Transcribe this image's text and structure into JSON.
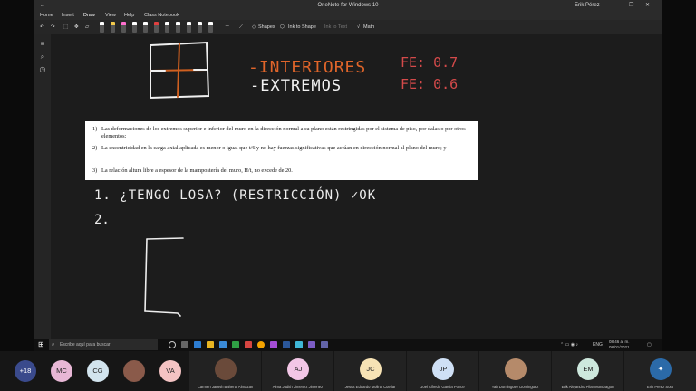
{
  "window": {
    "title": "OneNote for Windows 10",
    "user": "Erik Pérez",
    "controls": [
      "—",
      "❐",
      "✕"
    ]
  },
  "menu": {
    "tabs": [
      "Home",
      "Insert",
      "Draw",
      "View",
      "Help",
      "Class Notebook"
    ],
    "active": "Draw"
  },
  "toolbar": {
    "undo": "↶",
    "redo": "↷",
    "shapes": "Shapes",
    "ink_to_shape": "Ink to Shape",
    "ink_to_text": "Ink to Text",
    "math": "Math",
    "pen_colors": [
      "#ffffff",
      "#f2c94c",
      "#ff6fcf",
      "#ffffff",
      "#ffffff",
      "#e04040",
      "#ffffff",
      "#ffffff",
      "#ffffff",
      "#ffffff",
      "#ffffff"
    ]
  },
  "document": {
    "items": [
      {
        "num": "1)",
        "text": "Las deformaciones de los extremos superior e inferior del muro en la dirección normal a su plano están restringidas por el sistema de piso, por dalas o por otros elementos;"
      },
      {
        "num": "2)",
        "text": "La excentricidad en la carga axial aplicada es menor o igual que t/6 y no hay fuerzas significativas que actúan en dirección normal al plano del muro; y"
      },
      {
        "num": "3)",
        "text": "La relación altura libre a espesor de la mampostería del muro, H/t, no excede de 20."
      }
    ]
  },
  "handwriting": {
    "interiores": "-INTERIORES",
    "extremos": "-EXTREMOS",
    "fe_interiores": "FE: 0.7",
    "fe_extremos": "FE: 0.6",
    "line1": "1. ¿TENGO LOSA? (RESTRICCIÓN) ✓OK",
    "line2": "2."
  },
  "taskbar": {
    "search_placeholder": "Escribe aquí para buscar",
    "lang": "ENG",
    "time": "08:46 a. m.",
    "date": "08/01/2021"
  },
  "participants": {
    "overflow": "+18",
    "left": [
      {
        "initials": "MC",
        "color": "#e8b7d6"
      },
      {
        "initials": "CG",
        "color": "#d2e4ee"
      },
      {
        "initials": "",
        "color": "#8a5a4a"
      },
      {
        "initials": "VA",
        "color": "#f4c3c3"
      }
    ],
    "tiles": [
      {
        "name": "Carmen Janeth Bahena Almazan",
        "initials": "",
        "color": "#6a4a3a"
      },
      {
        "name": "Alma Judith Jimenez Jimenez",
        "initials": "AJ",
        "color": "#f2c6e6"
      },
      {
        "name": "Jesus Eduardo Molina Cuellar",
        "initials": "JC",
        "color": "#f7e3b5"
      },
      {
        "name": "Joel Alfredo Garcia Ponce",
        "initials": "JP",
        "color": "#cfe0f5"
      },
      {
        "name": "Yair Dominguez Dominguez",
        "initials": "",
        "color": "#b58a6a"
      },
      {
        "name": "Erik Alejandro Pilar Mondragon",
        "initials": "EM",
        "color": "#cde8dd"
      },
      {
        "name": "Erik Perez Soto",
        "initials": "",
        "color": "#2b6aa8"
      }
    ]
  }
}
